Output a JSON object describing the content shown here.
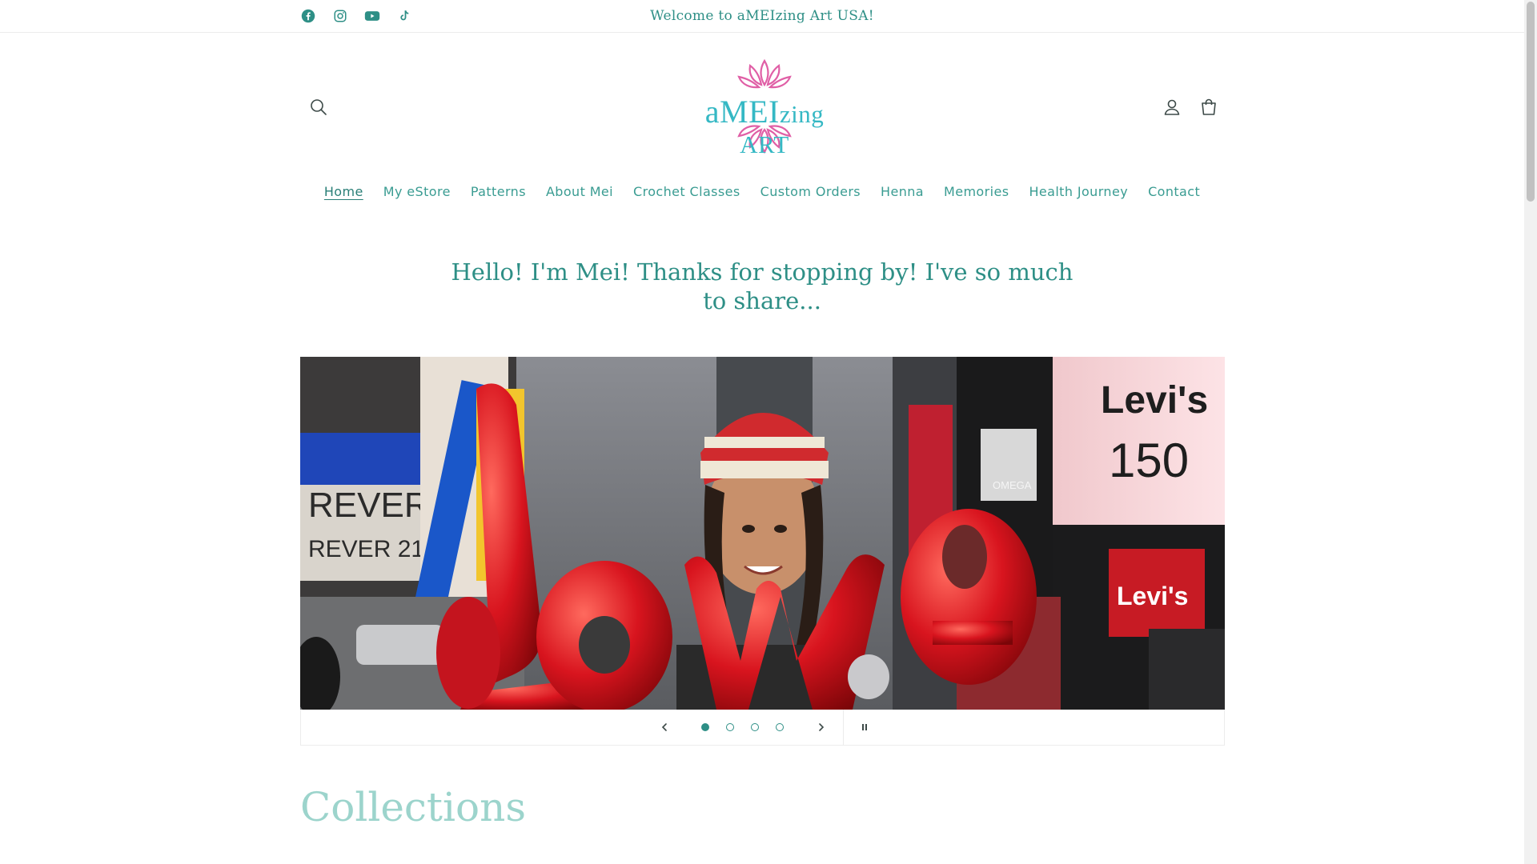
{
  "announcement": {
    "text": "Welcome to aMEIzing Art USA!"
  },
  "socials": [
    "facebook-icon",
    "instagram-icon",
    "youtube-icon",
    "tiktok-icon"
  ],
  "logo": {
    "text_prefix": "aMEI",
    "text_middle": "zing",
    "text_suffix": " ART"
  },
  "nav": {
    "items": [
      {
        "label": "Home",
        "active": true
      },
      {
        "label": "My eStore"
      },
      {
        "label": "Patterns"
      },
      {
        "label": "About Mei"
      },
      {
        "label": "Crochet Classes"
      },
      {
        "label": "Custom Orders"
      },
      {
        "label": "Henna"
      },
      {
        "label": "Memories"
      },
      {
        "label": "Health Journey"
      },
      {
        "label": "Contact"
      }
    ]
  },
  "hero": {
    "heading": "Hello! I'm Mei! Thanks for stopping by! I've so much to share..."
  },
  "slideshow": {
    "slide_count": 4,
    "active_slide": 1
  },
  "sections": {
    "collections_title": "Collections"
  },
  "colors": {
    "accent": "#2e8f86",
    "logo_teal": "#35b8c4",
    "logo_pink": "#e05fa6",
    "balloon_red": "#d8141e"
  }
}
